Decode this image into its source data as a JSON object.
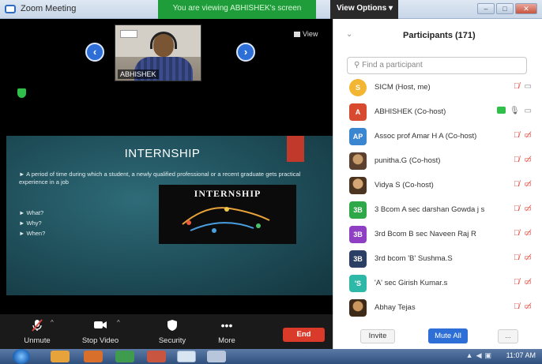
{
  "window": {
    "title": "Zoom Meeting",
    "share_banner": "You are viewing ABHISHEK's screen",
    "view_options": "View Options ▾"
  },
  "video": {
    "speaker_name": "ABHISHEK",
    "view_label": "View",
    "prev_arrow": "‹",
    "next_arrow": "›"
  },
  "slide": {
    "title": "INTERNSHIP",
    "body": "► A period of time during which a student, a newly qualified professional or a recent graduate gets practical experience in a job",
    "bullets": [
      "► What?",
      "► Why?",
      "► When?"
    ],
    "image_wordart": "INTERNSHIP"
  },
  "toolbar": {
    "unmute": "Unmute",
    "stop_video": "Stop Video",
    "security": "Security",
    "more": "More",
    "end": "End",
    "caret": "^",
    "more_dots": "•••"
  },
  "participants": {
    "title": "Participants (171)",
    "search_placeholder": "Find a participant",
    "collapse": "⌄",
    "list": [
      {
        "initials": "S",
        "name": "SICM (Host, me)",
        "color": "#f2b632"
      },
      {
        "initials": "A",
        "name": "ABHISHEK (Co-host)",
        "color": "#d84a2f"
      },
      {
        "initials": "AP",
        "name": "Assoc prof Amar H A (Co-host)",
        "color": "#3a86d1"
      },
      {
        "initials": "",
        "name": "punitha.G (Co-host)",
        "color": "#8c6b45"
      },
      {
        "initials": "",
        "name": "Vidya S (Co-host)",
        "color": "#8a6a3a"
      },
      {
        "initials": "3B",
        "name": "3 Bcom A sec darshan Gowda j s",
        "color": "#2fa84a"
      },
      {
        "initials": "3B",
        "name": "3rd Bcom B sec Naveen Raj R",
        "color": "#8e3fc4"
      },
      {
        "initials": "3B",
        "name": "3rd bcom 'B' Sushma.S",
        "color": "#2b3e63"
      },
      {
        "initials": "'S",
        "name": "'A' sec Girish Kumar.s",
        "color": "#2db8a8"
      },
      {
        "initials": "",
        "name": "Abhay Tejas",
        "color": "#6b4a2f"
      }
    ],
    "invite": "Invite",
    "mute_all": "Mute All",
    "more": "..."
  },
  "taskbar": {
    "time": "11:07 AM"
  }
}
